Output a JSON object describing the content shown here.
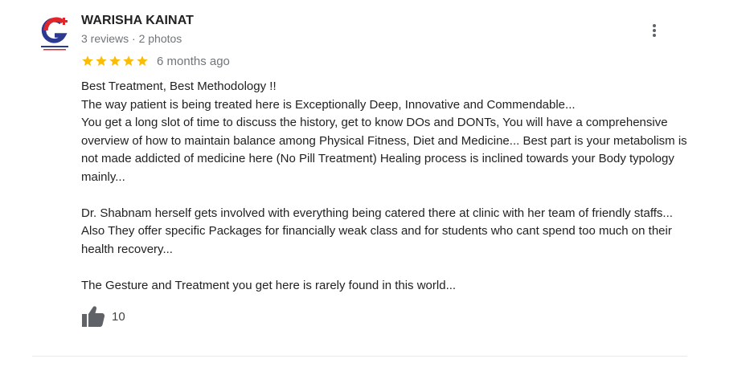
{
  "review": {
    "author": {
      "name": "WARISHA KAINAT",
      "meta": "3 reviews · 2 photos",
      "avatar_icon": "galaxy-logo-icon",
      "avatar_colors": {
        "red": "#e0262b",
        "blue": "#2b3990"
      }
    },
    "rating": {
      "stars": 5,
      "max": 5,
      "star_color": "#fbbc04",
      "time": "6 months ago"
    },
    "text": {
      "line1": "Best Treatment, Best Methodology !!",
      "line2": "The way patient is being treated here is Exceptionally Deep, Innovative and Commendable...",
      "line3": "You get a long slot of time to discuss the history, get to know DOs and DONTs, You will have a comprehensive overview of how to maintain balance among Physical Fitness, Diet and Medicine... Best part is your metabolism is not made addicted of medicine here (No Pill Treatment) Healing process is inclined towards your Body typology mainly...",
      "para2": "Dr. Shabnam herself gets involved with everything being catered there at clinic with her team of friendly staffs... Also They offer specific Packages for financially weak class and for students who cant spend too much on their health recovery...",
      "para3": "The Gesture and Treatment you get here is rarely found in this world..."
    },
    "likes": {
      "count": "10",
      "icon": "thumbs-up-icon"
    },
    "menu_icon": "more-vert-icon"
  }
}
